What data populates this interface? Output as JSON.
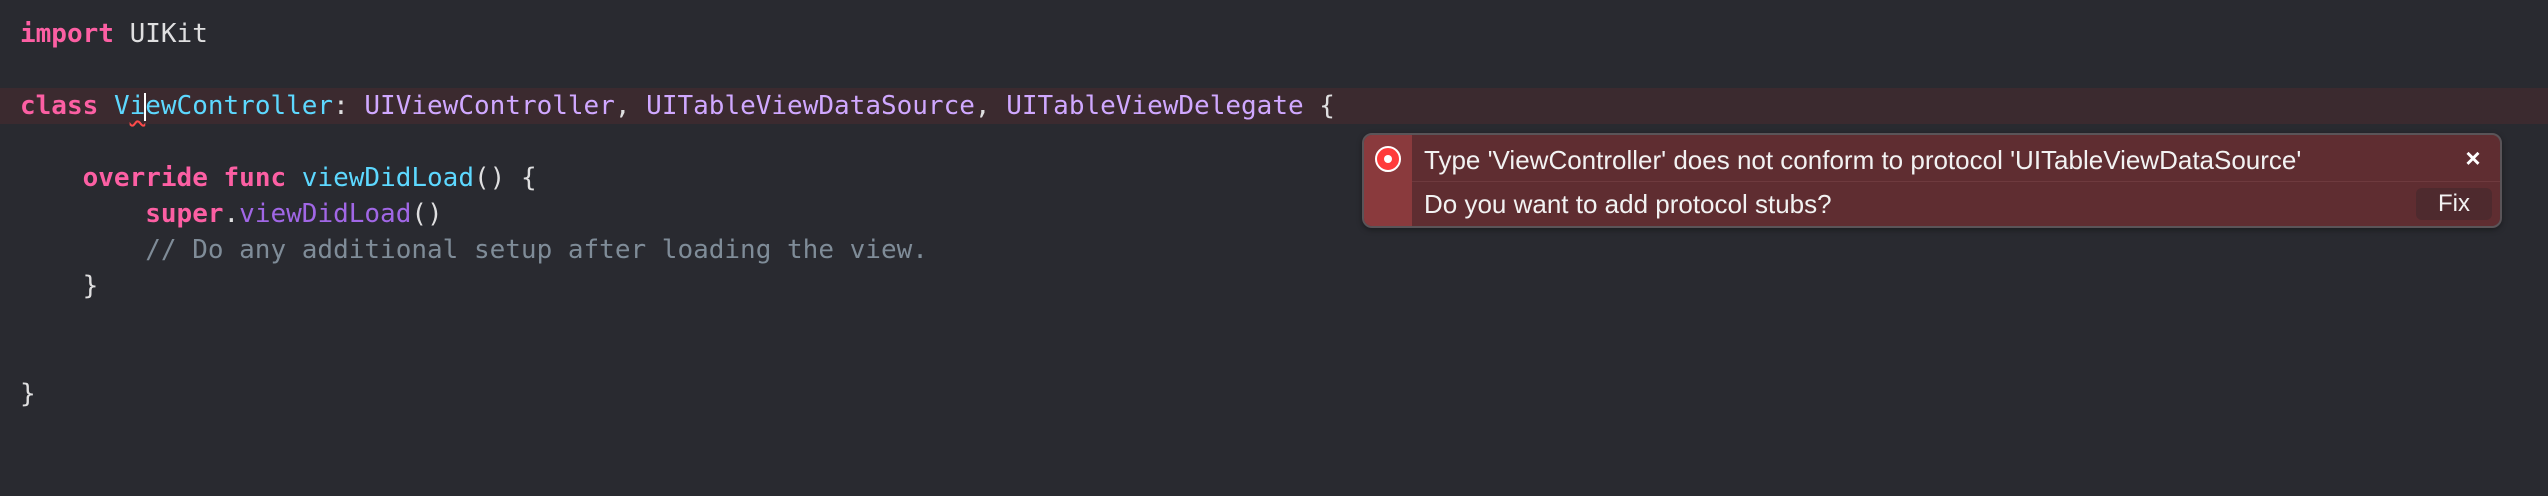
{
  "editor": {
    "line1": {
      "kw": "import",
      "rest": " UIKit"
    },
    "line2": {
      "kw": "class",
      "name_first": "V",
      "name_underlined": "i",
      "name_rest": "ewController",
      "colon": ": ",
      "t1": "UIViewController",
      "c1": ", ",
      "t2": "UITableViewDataSource",
      "c2": ", ",
      "t3": "UITableViewDelegate",
      "brace": " {"
    },
    "line3": {
      "indent": "    ",
      "kw1": "override",
      "sp": " ",
      "kw2": "func",
      "sp2": " ",
      "fn": "viewDidLoad",
      "rest": "() {"
    },
    "line4": {
      "indent": "        ",
      "kw": "super",
      "dot": ".",
      "method": "viewDidLoad",
      "rest": "()"
    },
    "line5": {
      "indent": "        ",
      "comment": "// Do any additional setup after loading the view."
    },
    "line6": {
      "indent": "    ",
      "brace": "}"
    },
    "line7": {
      "brace": "}"
    }
  },
  "fixit": {
    "message": "Type 'ViewController' does not conform to protocol 'UITableViewDataSource'",
    "question": "Do you want to add protocol stubs?",
    "fix_label": "Fix",
    "close_label": "×",
    "icon": "error-circle-icon",
    "accent": "#8a3a3d"
  }
}
